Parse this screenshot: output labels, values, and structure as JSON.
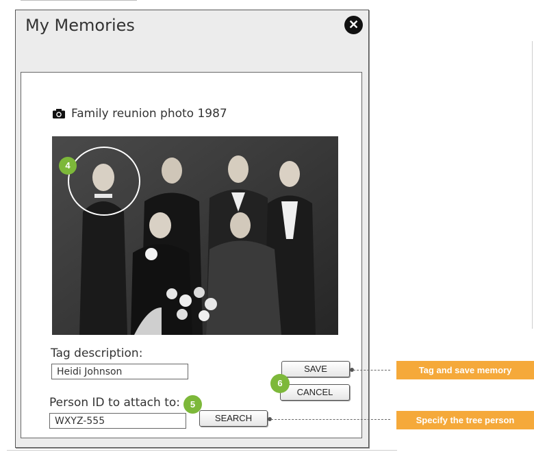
{
  "window": {
    "title": "My Memories"
  },
  "memory": {
    "heading": "Family reunion photo 1987",
    "tag_label": "Tag description:",
    "tag_value": "Heidi Johnson",
    "person_label": "Person ID to attach to:",
    "person_value": "WXYZ-555"
  },
  "buttons": {
    "save": "SAVE",
    "cancel": "CANCEL",
    "search": "SEARCH"
  },
  "badges": {
    "photo_tag": "4",
    "person": "5",
    "actions": "6"
  },
  "callouts": {
    "save": "Tag and save memory",
    "search": "Specify the tree person"
  },
  "colors": {
    "badge": "#7db83a",
    "callout": "#f5a93a"
  }
}
